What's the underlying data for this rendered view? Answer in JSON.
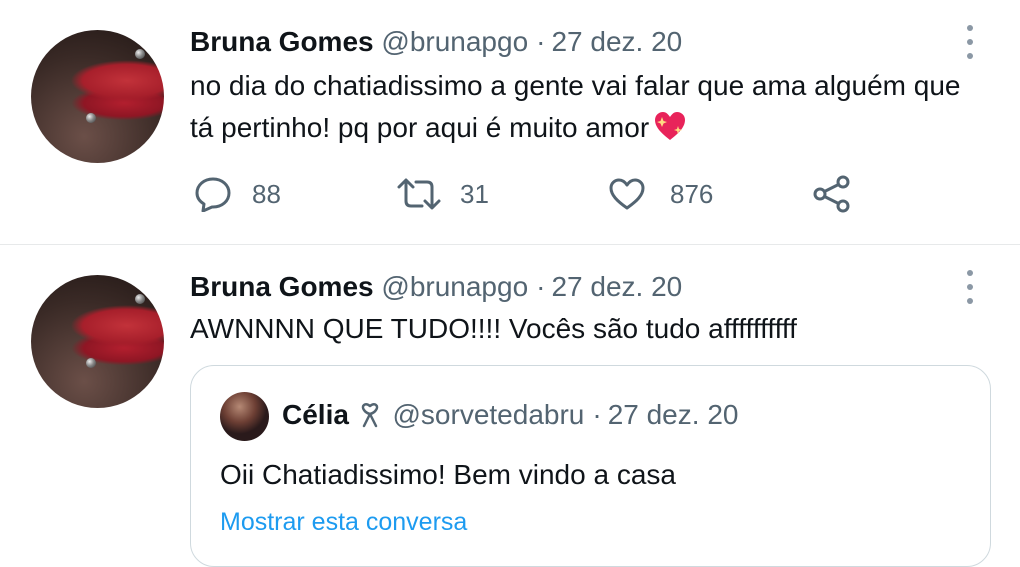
{
  "tweets": [
    {
      "author_name": "Bruna Gomes",
      "handle": "@brunapgo",
      "separator": "·",
      "date": "27 dez. 20",
      "text": "no dia do chatiadissimo a gente vai falar que ama alguém que tá pertinho! pq por aqui é muito amor",
      "emoji": "sparkling-heart",
      "actions": {
        "replies": "88",
        "retweets": "31",
        "likes": "876"
      }
    },
    {
      "author_name": "Bruna Gomes",
      "handle": "@brunapgo",
      "separator": "·",
      "date": "27 dez. 20",
      "text": "AWNNNN QUE TUDO!!!! Vocês são tudo affffffffff",
      "quote": {
        "author_name": "Célia",
        "badge": "ribbon",
        "handle": "@sorvetedabru",
        "separator": "·",
        "date": "27 dez. 20",
        "text": "Oii Chatiadissimo! Bem vindo a casa",
        "link": "Mostrar esta conversa"
      }
    }
  ],
  "colors": {
    "text": "#0f1419",
    "secondary": "#536471",
    "link": "#1d9bf0",
    "border": "#cfd9de",
    "heart_emoji": "#e8235a"
  }
}
